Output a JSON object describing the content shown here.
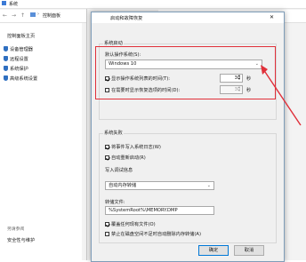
{
  "background_window": {
    "title": "系统",
    "breadcrumb_root": "控制面板",
    "left_links": [
      {
        "label": "控制面板主页",
        "icon": "none"
      },
      {
        "label": "设备管理器",
        "icon": "shield-icon"
      },
      {
        "label": "远程设置",
        "icon": "shield-icon"
      },
      {
        "label": "系统保护",
        "icon": "shield-icon"
      },
      {
        "label": "高级系统设置",
        "icon": "shield-icon"
      }
    ],
    "see_also": "另请参阅",
    "security": "安全性与维护",
    "mid_tab_fragment": "计"
  },
  "dialog": {
    "title": "启动和故障恢复",
    "close_glyph": "✕",
    "system_startup": {
      "group_label": "系统启动",
      "default_os_label": "默认操作系统(S):",
      "default_os_value": "Windows 10",
      "show_os_list": {
        "label": "显示操作系统列表的时间(T):",
        "checked": true,
        "value": "30",
        "unit": "秒"
      },
      "show_recovery": {
        "label": "在需要时显示恢复选项的时间(D):",
        "checked": false,
        "value": "30",
        "unit": "秒"
      }
    },
    "system_failure": {
      "group_label": "系统失败",
      "write_event": {
        "label": "将事件写入系统日志(W)",
        "checked": true
      },
      "auto_restart": {
        "label": "自动重新启动(R)",
        "checked": true
      },
      "debug_info_label": "写入调试信息",
      "debug_type": "自动内存转储",
      "dump_file_label": "转储文件:",
      "dump_file_value": "%SystemRoot%\\MEMORY.DMP",
      "overwrite": {
        "label": "覆盖任何现有文件(O)",
        "checked": true
      },
      "disable_auto_delete": {
        "label": "禁止在磁盘空间不足时自动删除内存转储(A)",
        "checked": false
      }
    },
    "ok_label": "确定",
    "cancel_label": "取消"
  },
  "colors": {
    "annotation": "#e0303a",
    "accent": "#0078d7"
  }
}
